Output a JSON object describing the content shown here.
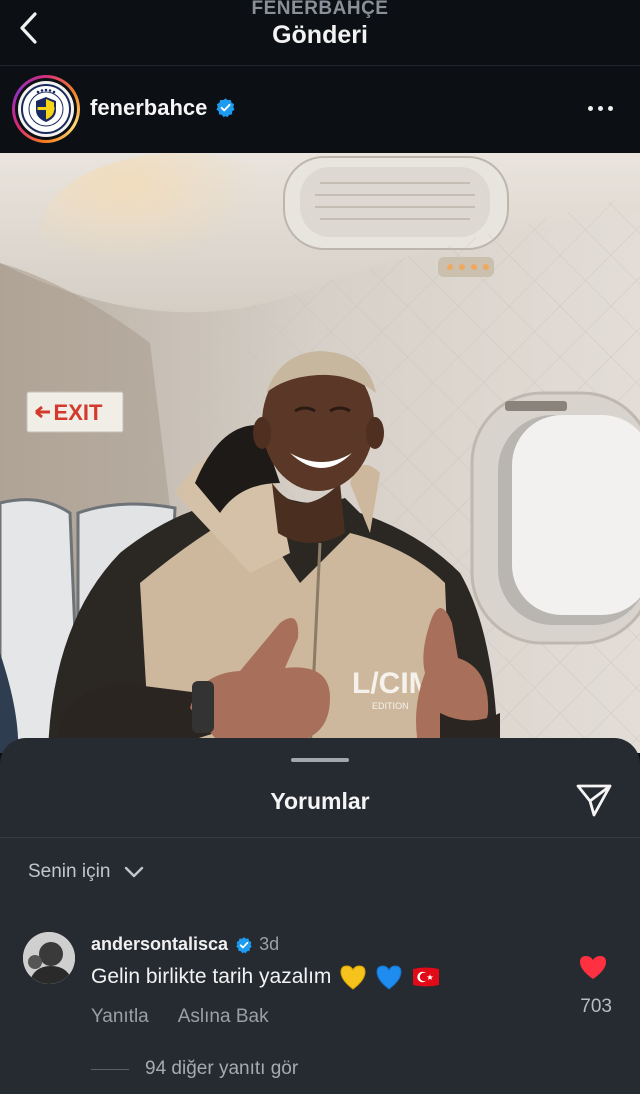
{
  "header": {
    "subtitle": "FENERBAHÇE",
    "title": "Gönderi"
  },
  "post": {
    "username": "fenerbahce",
    "verified": true
  },
  "photo": {
    "exit_sign": "EXIT",
    "shirt_text": "L/CIMA",
    "shirt_small": "EDITION"
  },
  "comments_sheet": {
    "title": "Yorumlar",
    "filter_label": "Senin için",
    "comments": [
      {
        "username": "andersontalisca",
        "verified": true,
        "time": "3d",
        "text": "Gelin birlikte tarih yazalım",
        "emojis": [
          "yellow-heart",
          "blue-heart",
          "turkey-flag"
        ],
        "reply_label": "Yanıtla",
        "translate_label": "Aslına Bak",
        "likes": "703",
        "view_replies": "94 diğer yanıtı gör"
      }
    ]
  },
  "colors": {
    "background": "#0c0f14",
    "sheet": "#262a31",
    "like": "#ff3040",
    "verified": "#1d9bf0"
  }
}
